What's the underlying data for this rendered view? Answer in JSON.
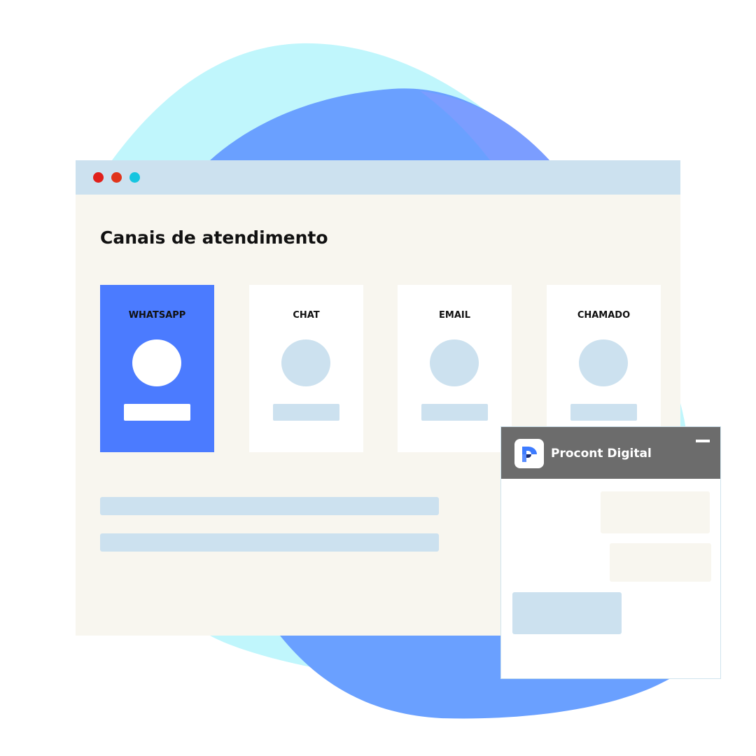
{
  "colors": {
    "accent_blue": "#4b7bff",
    "blob_cyan": "#c0f6fc",
    "blob_blue": "#6aa0ff",
    "placeholder": "#cce1ef",
    "window_bg": "#f8f6ef",
    "titlebar_bg": "#cce1ef",
    "chat_header_bg": "#6c6c6c"
  },
  "window": {
    "title": "Canais de atendimento",
    "traffic_lights": [
      {
        "name": "close",
        "color": "#e0201b"
      },
      {
        "name": "minimize",
        "color": "#e0341b"
      },
      {
        "name": "maximize",
        "color": "#16c5e0"
      }
    ]
  },
  "channels": [
    {
      "label": "WHATSAPP",
      "active": true
    },
    {
      "label": "CHAT",
      "active": false
    },
    {
      "label": "EMAIL",
      "active": false
    },
    {
      "label": "CHAMADO",
      "active": false
    }
  ],
  "chat_widget": {
    "title": "Procont Digital",
    "logo_icon": "procont-logo-icon",
    "minimize_icon": "minimize-icon"
  }
}
